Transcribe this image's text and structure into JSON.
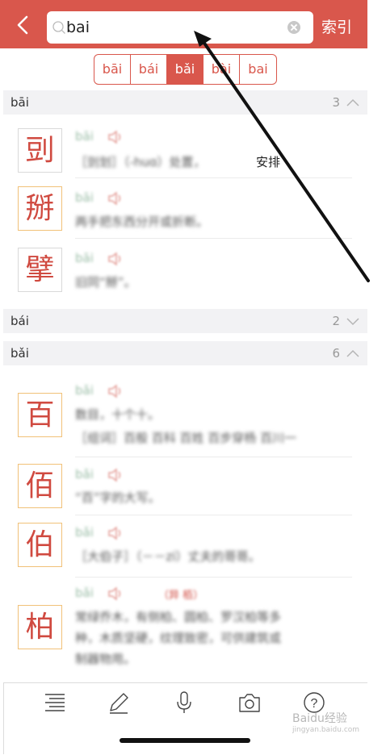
{
  "header": {
    "back_icon": "chevron-left-icon",
    "search_value": "bai",
    "search_placeholder": "",
    "index_label": "索引"
  },
  "tones": [
    "bāi",
    "bái",
    "bǎi",
    "bài",
    "bai"
  ],
  "active_tone_index": 2,
  "sections": [
    {
      "pinyin": "bāi",
      "count": "3",
      "expanded": true
    },
    {
      "pinyin": "bái",
      "count": "2",
      "expanded": false
    },
    {
      "pinyin": "bǎi",
      "count": "6",
      "expanded": true
    }
  ],
  "entries": [
    {
      "char": "剅",
      "pinyin": "bāi",
      "lines": [
        "［剅划］（-huɑ）处置，"
      ],
      "clear_tail": "安排"
    },
    {
      "char": "掰",
      "pinyin": "bāi",
      "lines": [
        "两手把东西分开或折断。"
      ]
    },
    {
      "char": "擘",
      "pinyin": "bāi",
      "lines": [
        "旧同“掰”。"
      ]
    },
    {
      "char": "百",
      "pinyin": "bǎi",
      "lines": [
        "数目，十个十。",
        "［组词］百般 百科 百姓 百步穿杨 百川一"
      ]
    },
    {
      "char": "佰",
      "pinyin": "bǎi",
      "lines": [
        "“百”字的大写。"
      ]
    },
    {
      "char": "伯",
      "pinyin": "bǎi",
      "lines": [
        "［大伯子］（－－zi）丈夫的哥哥。"
      ]
    },
    {
      "char": "柏",
      "pinyin": "bǎi",
      "extra": "（异 栢）",
      "lines": [
        "常绿乔木，有侧柏、圆柏、罗汉柏等多",
        "种，木质坚硬，纹理致密，可供建筑或",
        "制器物用。"
      ]
    }
  ],
  "toolbar": [
    "strokes-icon",
    "pencil-icon",
    "microphone-icon",
    "camera-icon",
    "help-icon"
  ],
  "help_glyph": "?",
  "watermark": {
    "brand": "Baidu经验",
    "url": "jingyan.baidu.com"
  },
  "colors": {
    "accent": "#d9574c",
    "char_red": "#d04a40",
    "section_bg": "#f2f2f4"
  }
}
